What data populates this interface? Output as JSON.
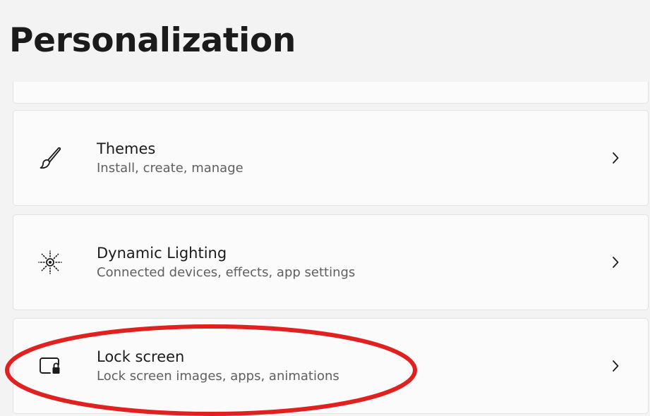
{
  "page": {
    "title": "Personalization"
  },
  "settings_items": [
    {
      "title": "Themes",
      "subtitle": "Install, create, manage",
      "icon": "paintbrush-icon"
    },
    {
      "title": "Dynamic Lighting",
      "subtitle": "Connected devices, effects, app settings",
      "icon": "dynamic-lighting-icon"
    },
    {
      "title": "Lock screen",
      "subtitle": "Lock screen images, apps, animations",
      "icon": "lock-screen-icon"
    }
  ],
  "colors": {
    "background": "#f3f3f3",
    "card": "#fbfbfb",
    "card_border": "#e3e3e3",
    "title_text": "#1b1b1b",
    "subtitle_text": "#5f5f5f",
    "annotation": "#e12020"
  }
}
